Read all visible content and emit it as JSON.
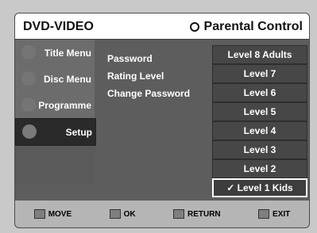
{
  "header": {
    "title": "DVD-VIDEO",
    "section": "Parental Control"
  },
  "sidebar": {
    "items": [
      {
        "label": "Title Menu"
      },
      {
        "label": "Disc Menu"
      },
      {
        "label": "Programme"
      },
      {
        "label": "Setup"
      }
    ]
  },
  "main": {
    "labels": [
      "Password",
      "Rating Level",
      "Change Password"
    ]
  },
  "levels": [
    "Level 8 Adults",
    "Level 7",
    "Level 6",
    "Level 5",
    "Level 4",
    "Level 3",
    "Level 2",
    "✓ Level 1 Kids"
  ],
  "footer": {
    "move": "MOVE",
    "ok": "OK",
    "return": "RETURN",
    "exit": "EXIT"
  }
}
